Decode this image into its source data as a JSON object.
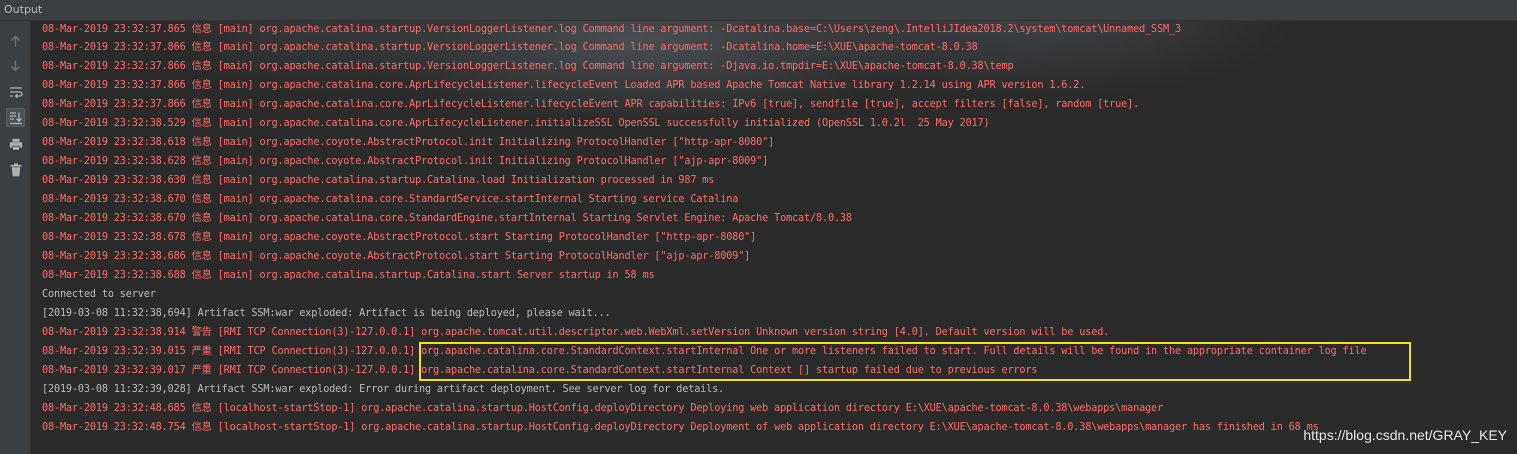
{
  "window": {
    "title": "Output"
  },
  "toolbar": {
    "buttons": [
      {
        "icon": "arrow-up-icon"
      },
      {
        "icon": "arrow-down-icon"
      },
      {
        "icon": "soft-wrap-icon"
      },
      {
        "icon": "scroll-to-end-icon"
      },
      {
        "icon": "print-icon"
      },
      {
        "icon": "trash-icon"
      }
    ]
  },
  "colors": {
    "error_text": "#ff6b68",
    "info_text": "#bbbbbb",
    "highlight": "#f5e21b",
    "background": "#2b2b2b",
    "panel": "#3c3f41"
  },
  "console": {
    "lines": [
      {
        "type": "err",
        "text": "08-Mar-2019 23:32:37.865 信息 [main] org.apache.catalina.startup.VersionLoggerListener.log Command line argument: -Dcatalina.base=C:\\Users\\zeng\\.IntelliJIdea2018.2\\system\\tomcat\\Unnamed_SSM_3"
      },
      {
        "type": "err",
        "text": "08-Mar-2019 23:32:37.866 信息 [main] org.apache.catalina.startup.VersionLoggerListener.log Command line argument: -Dcatalina.home=E:\\XUE\\apache-tomcat-8.0.38"
      },
      {
        "type": "err",
        "text": "08-Mar-2019 23:32:37.866 信息 [main] org.apache.catalina.startup.VersionLoggerListener.log Command line argument: -Djava.io.tmpdir=E:\\XUE\\apache-tomcat-8.0.38\\temp"
      },
      {
        "type": "err",
        "text": "08-Mar-2019 23:32:37.866 信息 [main] org.apache.catalina.core.AprLifecycleListener.lifecycleEvent Loaded APR based Apache Tomcat Native library 1.2.14 using APR version 1.6.2."
      },
      {
        "type": "err",
        "text": "08-Mar-2019 23:32:37.866 信息 [main] org.apache.catalina.core.AprLifecycleListener.lifecycleEvent APR capabilities: IPv6 [true], sendfile [true], accept filters [false], random [true]."
      },
      {
        "type": "err",
        "text": "08-Mar-2019 23:32:38.529 信息 [main] org.apache.catalina.core.AprLifecycleListener.initializeSSL OpenSSL successfully initialized (OpenSSL 1.0.2l  25 May 2017)"
      },
      {
        "type": "err",
        "text": "08-Mar-2019 23:32:38.618 信息 [main] org.apache.coyote.AbstractProtocol.init Initializing ProtocolHandler [\"http-apr-8080\"]"
      },
      {
        "type": "err",
        "text": "08-Mar-2019 23:32:38.628 信息 [main] org.apache.coyote.AbstractProtocol.init Initializing ProtocolHandler [\"ajp-apr-8009\"]"
      },
      {
        "type": "err",
        "text": "08-Mar-2019 23:32:38.630 信息 [main] org.apache.catalina.startup.Catalina.load Initialization processed in 987 ms"
      },
      {
        "type": "err",
        "text": "08-Mar-2019 23:32:38.670 信息 [main] org.apache.catalina.core.StandardService.startInternal Starting service Catalina"
      },
      {
        "type": "err",
        "text": "08-Mar-2019 23:32:38.670 信息 [main] org.apache.catalina.core.StandardEngine.startInternal Starting Servlet Engine: Apache Tomcat/8.0.38"
      },
      {
        "type": "err",
        "text": "08-Mar-2019 23:32:38.678 信息 [main] org.apache.coyote.AbstractProtocol.start Starting ProtocolHandler [\"http-apr-8080\"]"
      },
      {
        "type": "err",
        "text": "08-Mar-2019 23:32:38.686 信息 [main] org.apache.coyote.AbstractProtocol.start Starting ProtocolHandler [\"ajp-apr-8009\"]"
      },
      {
        "type": "err",
        "text": "08-Mar-2019 23:32:38.688 信息 [main] org.apache.catalina.startup.Catalina.start Server startup in 58 ms"
      },
      {
        "type": "info",
        "text": "Connected to server"
      },
      {
        "type": "info",
        "text": "[2019-03-08 11:32:38,694] Artifact SSM:war exploded: Artifact is being deployed, please wait..."
      },
      {
        "type": "err",
        "text": "08-Mar-2019 23:32:38.914 警告 [RMI TCP Connection(3)-127.0.0.1] org.apache.tomcat.util.descriptor.web.WebXml.setVersion Unknown version string [4.0]. Default version will be used."
      },
      {
        "type": "err",
        "text": "08-Mar-2019 23:32:39.015 严重 [RMI TCP Connection(3)-127.0.0.1] org.apache.catalina.core.StandardContext.startInternal One or more listeners failed to start. Full details will be found in the appropriate container log file"
      },
      {
        "type": "err",
        "text": "08-Mar-2019 23:32:39.017 严重 [RMI TCP Connection(3)-127.0.0.1] org.apache.catalina.core.StandardContext.startInternal Context [] startup failed due to previous errors"
      },
      {
        "type": "info",
        "text": "[2019-03-08 11:32:39,028] Artifact SSM:war exploded: Error during artifact deployment. See server log for details."
      },
      {
        "type": "err",
        "text": "08-Mar-2019 23:32:48.685 信息 [localhost-startStop-1] org.apache.catalina.startup.HostConfig.deployDirectory Deploying web application directory E:\\XUE\\apache-tomcat-8.0.38\\webapps\\manager"
      },
      {
        "type": "err",
        "text": "08-Mar-2019 23:32:48.754 信息 [localhost-startStop-1] org.apache.catalina.startup.HostConfig.deployDirectory Deployment of web application directory E:\\XUE\\apache-tomcat-8.0.38\\webapps\\manager has finished in 68 ms"
      }
    ]
  },
  "watermark": {
    "text": "https://blog.csdn.net/GRAY_KEY"
  }
}
